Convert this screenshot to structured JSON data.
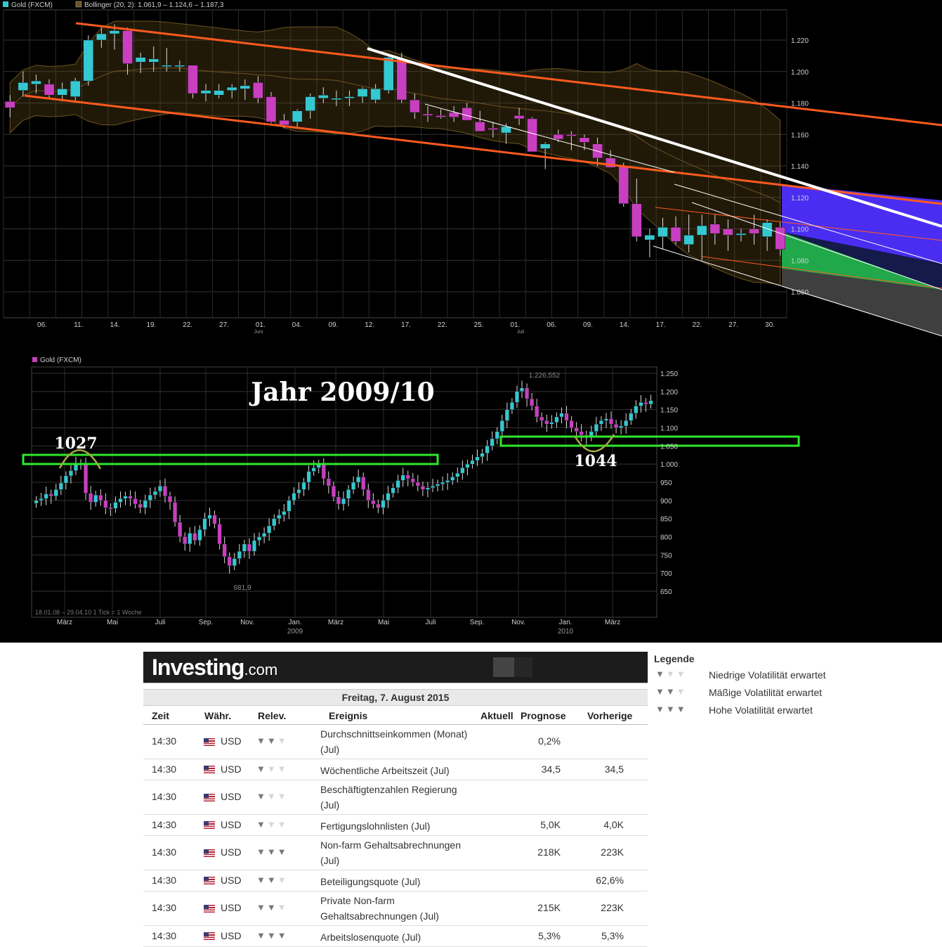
{
  "chart1": {
    "legend_gold": "Gold (FXCM)",
    "legend_bollinger": "Bollinger (20, 2): 1.061,9 – 1.124,6 – 1.187,3",
    "y_ticks": [
      "1.220",
      "1.200",
      "1.180",
      "1.160",
      "1.140",
      "1.120",
      "1.100",
      "1.080",
      "1.060"
    ],
    "x_ticks": [
      "06.",
      "11.",
      "14.",
      "19.",
      "22.",
      "27.",
      "01.",
      "04.",
      "09.",
      "12.",
      "17.",
      "22.",
      "25.",
      "01.",
      "06.",
      "09.",
      "14.",
      "17.",
      "22.",
      "27.",
      "30."
    ],
    "x_sub_juni": "Juni",
    "x_sub_juli": "Juli"
  },
  "chart2": {
    "legend_gold": "Gold (FXCM)",
    "title": "Jahr 2009/10",
    "y_ticks": [
      "1.250",
      "1.200",
      "1.150",
      "1.100",
      "1.050",
      "1.000",
      "950",
      "900",
      "850",
      "800",
      "750",
      "700",
      "650"
    ],
    "x_ticks": [
      "März",
      "Mai",
      "Juli",
      "Sep.",
      "Nov.",
      "Jan.",
      "März",
      "Mai",
      "Juli",
      "Sep.",
      "Nov.",
      "Jan.",
      "März"
    ],
    "x_year_2009": "2009",
    "x_year_2010": "2010",
    "high_label": "1.226,552",
    "low_label": "681,9",
    "label_1027": "1027",
    "label_1044": "1044",
    "footer": "18.01.08 – 29.04.10   1 Tick = 1 Woche"
  },
  "calendar": {
    "logo_main": "Investing",
    "logo_suffix": ".com",
    "date": "Freitag, 7. August 2015",
    "headers": {
      "zeit": "Zeit",
      "waehr": "Währ.",
      "relev": "Relev.",
      "ereignis": "Ereignis",
      "aktuell": "Aktuell",
      "prognose": "Prognose",
      "vorherige": "Vorherige"
    },
    "rows": [
      {
        "time": "14:30",
        "cur": "USD",
        "rel": 2,
        "event": "Durchschnittseinkommen (Monat) (Jul)",
        "actual": "",
        "forecast": "0,2%",
        "previous": ""
      },
      {
        "time": "14:30",
        "cur": "USD",
        "rel": 1,
        "event": "Wöchentliche Arbeitszeit (Jul)",
        "actual": "",
        "forecast": "34,5",
        "previous": "34,5"
      },
      {
        "time": "14:30",
        "cur": "USD",
        "rel": 1,
        "event": "Beschäftigtenzahlen Regierung (Jul)",
        "actual": "",
        "forecast": "",
        "previous": ""
      },
      {
        "time": "14:30",
        "cur": "USD",
        "rel": 1,
        "event": "Fertigungslohnlisten (Jul)",
        "actual": "",
        "forecast": "5,0K",
        "previous": "4,0K"
      },
      {
        "time": "14:30",
        "cur": "USD",
        "rel": 3,
        "event": "Non-farm Gehaltsabrechnungen (Jul)",
        "actual": "",
        "forecast": "218K",
        "previous": "223K"
      },
      {
        "time": "14:30",
        "cur": "USD",
        "rel": 2,
        "event": "Beteiligungsquote (Jul)",
        "actual": "",
        "forecast": "",
        "previous": "62,6%"
      },
      {
        "time": "14:30",
        "cur": "USD",
        "rel": 2,
        "event": "Private Non-farm Gehaltsabrechnungen (Jul)",
        "actual": "",
        "forecast": "215K",
        "previous": "223K"
      },
      {
        "time": "14:30",
        "cur": "USD",
        "rel": 3,
        "event": "Arbeitslosenquote (Jul)",
        "actual": "",
        "forecast": "5,3%",
        "previous": "5,3%"
      }
    ]
  },
  "legend": {
    "title": "Legende",
    "items": [
      {
        "level": 1,
        "text": "Niedrige Volatilität erwartet"
      },
      {
        "level": 2,
        "text": "Mäßige Volatilität erwartet"
      },
      {
        "level": 3,
        "text": "Hohe Volatilität erwartet"
      }
    ]
  },
  "chart_data": [
    {
      "type": "candlestick",
      "title": "",
      "series_name": "Gold (FXCM)",
      "indicator": "Bollinger (20, 2): 1.061,9 – 1.124,6 – 1.187,3",
      "ylim": [
        1050,
        1235
      ],
      "colors": {
        "up": "#35c8d0",
        "down": "#c83fc0",
        "trend_orange": "#ff5a1e",
        "trend_white": "#ffffff",
        "zone_blue": "#4b2df2",
        "zone_green": "#22b04a",
        "zone_grey": "#3f3f3f"
      },
      "candles": [
        [
          1181,
          1185,
          1171,
          1177
        ],
        [
          1188,
          1200,
          1184,
          1193
        ],
        [
          1192,
          1198,
          1186,
          1194
        ],
        [
          1192,
          1195,
          1183,
          1185
        ],
        [
          1185,
          1193,
          1181,
          1189
        ],
        [
          1184,
          1196,
          1181,
          1194
        ],
        [
          1194,
          1223,
          1191,
          1220
        ],
        [
          1220,
          1228,
          1215,
          1224
        ],
        [
          1224,
          1230,
          1214,
          1226
        ],
        [
          1226,
          1228,
          1198,
          1205
        ],
        [
          1206,
          1212,
          1199,
          1209
        ],
        [
          1206,
          1216,
          1200,
          1208
        ],
        [
          1204,
          1215,
          1200,
          1204
        ],
        [
          1204,
          1207,
          1200,
          1204
        ],
        [
          1204,
          1204,
          1183,
          1186
        ],
        [
          1186,
          1192,
          1181,
          1188
        ],
        [
          1185,
          1192,
          1183,
          1188
        ],
        [
          1188,
          1192,
          1183,
          1190
        ],
        [
          1189,
          1195,
          1182,
          1191
        ],
        [
          1193,
          1197,
          1180,
          1183
        ],
        [
          1184,
          1187,
          1167,
          1168
        ],
        [
          1169,
          1173,
          1164,
          1166
        ],
        [
          1168,
          1176,
          1165,
          1175
        ],
        [
          1175,
          1186,
          1170,
          1184
        ],
        [
          1183,
          1190,
          1180,
          1185
        ],
        [
          1183,
          1188,
          1178,
          1183
        ],
        [
          1183,
          1188,
          1178,
          1184
        ],
        [
          1184,
          1190,
          1180,
          1189
        ],
        [
          1182,
          1192,
          1180,
          1189
        ],
        [
          1188,
          1210,
          1186,
          1209
        ],
        [
          1208,
          1212,
          1180,
          1182
        ],
        [
          1182,
          1186,
          1170,
          1174
        ],
        [
          1173,
          1178,
          1168,
          1172
        ],
        [
          1172,
          1176,
          1170,
          1171
        ],
        [
          1174,
          1178,
          1168,
          1171
        ],
        [
          1177,
          1180,
          1169,
          1169
        ],
        [
          1168,
          1175,
          1162,
          1162
        ],
        [
          1164,
          1168,
          1158,
          1163
        ],
        [
          1161,
          1167,
          1154,
          1165
        ],
        [
          1172,
          1177,
          1166,
          1170
        ],
        [
          1170,
          1171,
          1149,
          1149
        ],
        [
          1151,
          1155,
          1138,
          1154
        ],
        [
          1160,
          1163,
          1155,
          1157
        ],
        [
          1160,
          1162,
          1150,
          1159
        ],
        [
          1158,
          1160,
          1150,
          1155
        ],
        [
          1154,
          1158,
          1140,
          1145
        ],
        [
          1145,
          1150,
          1139,
          1139
        ],
        [
          1140,
          1142,
          1114,
          1116
        ],
        [
          1116,
          1132,
          1092,
          1095
        ],
        [
          1093,
          1100,
          1082,
          1096
        ],
        [
          1095,
          1107,
          1087,
          1101
        ],
        [
          1101,
          1108,
          1090,
          1092
        ],
        [
          1090,
          1109,
          1085,
          1096
        ],
        [
          1096,
          1109,
          1080,
          1102
        ],
        [
          1103,
          1109,
          1090,
          1097
        ],
        [
          1100,
          1106,
          1086,
          1096
        ],
        [
          1096,
          1100,
          1092,
          1097
        ],
        [
          1100,
          1109,
          1090,
          1097
        ],
        [
          1095,
          1106,
          1086,
          1104
        ],
        [
          1101,
          1104,
          1083,
          1087
        ]
      ]
    },
    {
      "type": "candlestick",
      "title": "Jahr 2009/10",
      "series_name": "Gold (FXCM)",
      "ylim": [
        600,
        1260
      ],
      "annotations": {
        "high": "1.226,552",
        "low": "681,9",
        "resistance_2008_09": "1027",
        "support_2010": "1044"
      },
      "colors": {
        "up": "#35c8d0",
        "down": "#c83fc0",
        "zone": "#2ee82e",
        "arc": "#a8a842"
      },
      "weekly_close": [
        900,
        905,
        918,
        912,
        930,
        948,
        968,
        982,
        1000,
        1002,
        920,
        895,
        915,
        900,
        880,
        878,
        895,
        905,
        912,
        905,
        890,
        880,
        900,
        915,
        925,
        940,
        912,
        895,
        840,
        800,
        780,
        810,
        790,
        820,
        850,
        860,
        835,
        780,
        745,
        720,
        740,
        760,
        780,
        760,
        790,
        800,
        810,
        830,
        850,
        860,
        870,
        900,
        920,
        930,
        950,
        980,
        990,
        1000,
        960,
        940,
        910,
        890,
        905,
        930,
        950,
        965,
        930,
        900,
        890,
        880,
        900,
        920,
        935,
        955,
        970,
        960,
        950,
        940,
        930,
        935,
        940,
        945,
        950,
        955,
        965,
        975,
        990,
        1000,
        1010,
        1020,
        1030,
        1050,
        1070,
        1090,
        1120,
        1150,
        1170,
        1200,
        1210,
        1180,
        1160,
        1130,
        1120,
        1110,
        1115,
        1130,
        1140,
        1120,
        1100,
        1090,
        1080,
        1075,
        1090,
        1110,
        1120,
        1125,
        1110,
        1100,
        1105,
        1120,
        1140,
        1160,
        1170,
        1165,
        1175
      ]
    }
  ]
}
